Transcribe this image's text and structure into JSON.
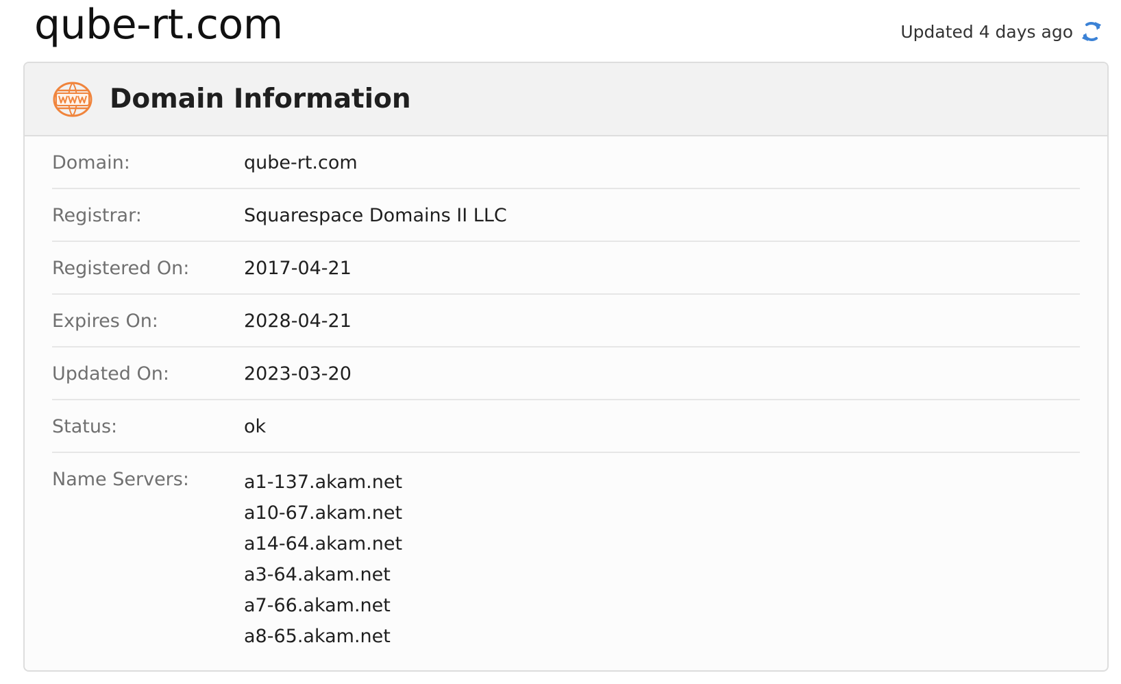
{
  "page": {
    "title": "qube-rt.com",
    "updated_text": "Updated 4 days ago",
    "refresh_icon": "refresh-icon",
    "accent_color": "#3b82d6"
  },
  "card": {
    "title": "Domain Information",
    "icon": "www-globe-icon",
    "icon_color": "#f0843c",
    "rows": [
      {
        "label": "Domain:",
        "value": "qube-rt.com"
      },
      {
        "label": "Registrar:",
        "value": "Squarespace Domains II LLC"
      },
      {
        "label": "Registered On:",
        "value": "2017-04-21"
      },
      {
        "label": "Expires On:",
        "value": "2028-04-21"
      },
      {
        "label": "Updated On:",
        "value": "2023-03-20"
      },
      {
        "label": "Status:",
        "value": "ok"
      }
    ],
    "name_servers": {
      "label": "Name Servers:",
      "values": [
        "a1-137.akam.net",
        "a10-67.akam.net",
        "a14-64.akam.net",
        "a3-64.akam.net",
        "a7-66.akam.net",
        "a8-65.akam.net"
      ]
    }
  }
}
